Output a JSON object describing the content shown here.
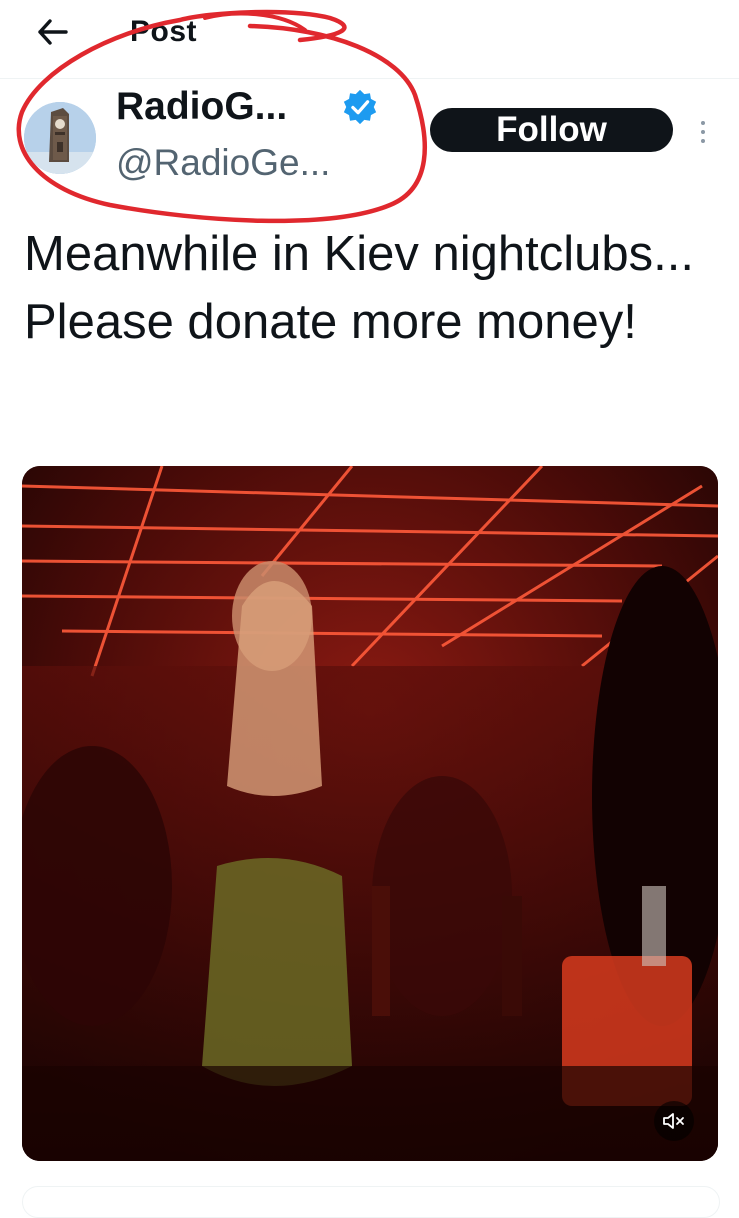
{
  "topbar": {
    "title": "Post",
    "back_icon": "arrow-left-icon"
  },
  "author": {
    "display_name": "RadioG...",
    "handle": "@RadioGe...",
    "verified": true,
    "verified_color": "#1d9bf0",
    "avatar_icon": "clock-tower-avatar"
  },
  "actions": {
    "follow_label": "Follow",
    "more_icon": "more-vertical-icon"
  },
  "post": {
    "text": "Meanwhile in Kiev nightclubs... Please donate more money!"
  },
  "media": {
    "type": "video",
    "mute_icon": "speaker-muted-icon"
  },
  "colors": {
    "annotation": "#e0282e",
    "follow_bg": "#0f1419",
    "handle": "#536471"
  }
}
